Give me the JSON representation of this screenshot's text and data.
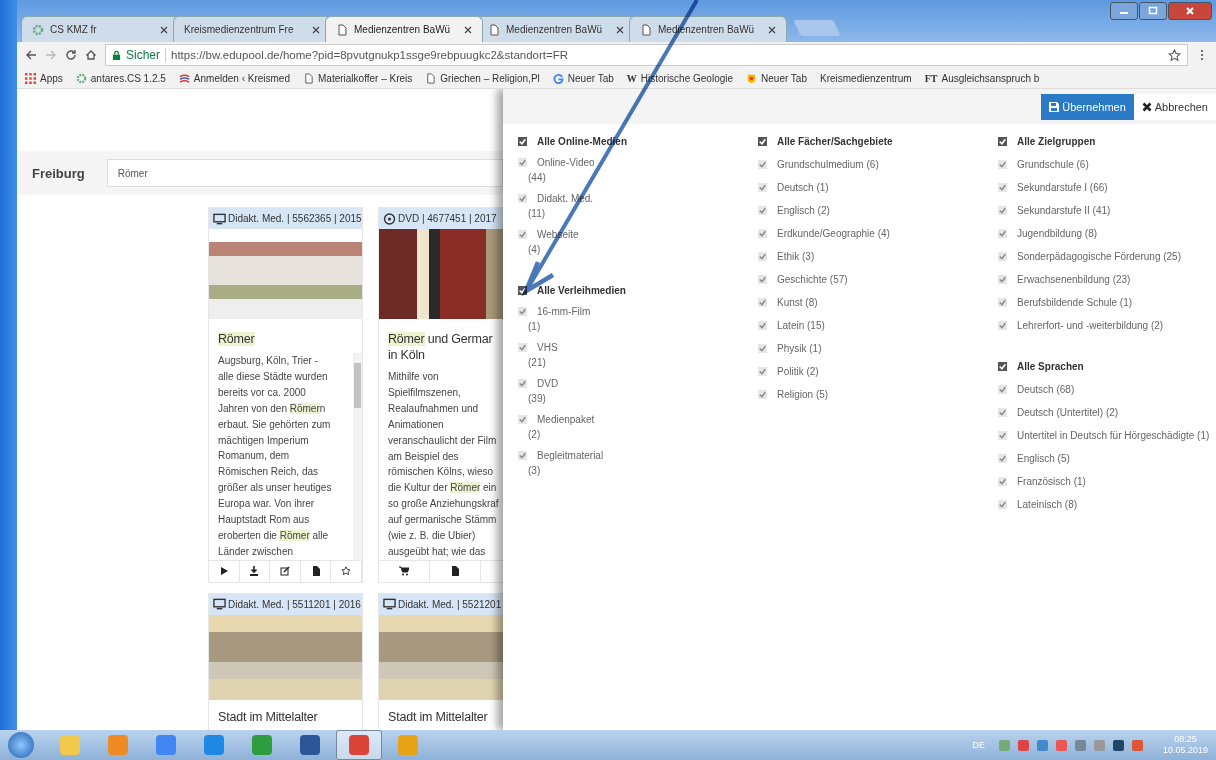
{
  "browser": {
    "tabs": [
      {
        "title": "CS KMZ fr",
        "selected": false
      },
      {
        "title": "Kreismedienzentrum Fre",
        "selected": false
      },
      {
        "title": "Medienzentren BaWü",
        "selected": true
      },
      {
        "title": "Medienzentren BaWü",
        "selected": false
      },
      {
        "title": "Medienzentren BaWü",
        "selected": false
      }
    ],
    "security": "Sicher",
    "url": "https://bw.edupool.de/home?pid=8pvutgnukp1ssge9rebpuugkc2&standort=FR",
    "bookmarks": [
      {
        "label": "Apps"
      },
      {
        "label": "antares.CS 1.2.5"
      },
      {
        "label": "Anmelden ‹ Kreismed"
      },
      {
        "label": "Materialkoffer – Kreis"
      },
      {
        "label": "Griechen – Religion,Pl"
      },
      {
        "label": "Neuer Tab"
      },
      {
        "label": "Historische Geologie",
        "mark": "W"
      },
      {
        "label": "Neuer Tab"
      },
      {
        "label": "Kreismedienzentrum"
      },
      {
        "label": "Ausgleichsanspruch b",
        "mark": "FT"
      }
    ]
  },
  "page": {
    "location": "Freiburg",
    "search": {
      "value": "Römer"
    },
    "cards": [
      {
        "kind": "didactic",
        "meta": "Didakt. Med. | 5562365 | 2015",
        "title": [
          [
            {
              "text": "Römer",
              "highlight": true
            }
          ]
        ],
        "description": [
          [
            {
              "text": "Augsburg, Köln, Trier -"
            }
          ],
          [
            {
              "text": "alle diese Städte wurden"
            }
          ],
          [
            {
              "text": "bereits vor ca. 2000"
            }
          ],
          [
            {
              "text": "Jahren von den "
            },
            {
              "text": "Römer",
              "highlight": true
            },
            {
              "text": "n"
            }
          ],
          [
            {
              "text": "erbaut. Sie gehörten zum"
            }
          ],
          [
            {
              "text": "mächtigen Imperium"
            }
          ],
          [
            {
              "text": "Romanum, dem"
            }
          ],
          [
            {
              "text": "Römischen Reich, das"
            }
          ],
          [
            {
              "text": "größer als unser heutiges"
            }
          ],
          [
            {
              "text": "Europa war. Von ihrer"
            }
          ],
          [
            {
              "text": "Hauptstadt Rom aus"
            }
          ],
          [
            {
              "text": "eroberten die "
            },
            {
              "text": "Römer",
              "highlight": true
            },
            {
              "text": " alle"
            }
          ],
          [
            {
              "text": "Länder zwischen"
            }
          ]
        ],
        "scrollable": true
      },
      {
        "kind": "dvd",
        "meta": "DVD | 4677451 | 2017",
        "title": [
          [
            {
              "text": "Römer",
              "highlight": true
            },
            {
              "text": " und Germar"
            }
          ],
          [
            {
              "text": "in Köln"
            }
          ]
        ],
        "description": [
          [
            {
              "text": "Mithilfe von"
            }
          ],
          [
            {
              "text": "Spielfilmszenen,"
            }
          ],
          [
            {
              "text": "Realaufnahmen und"
            }
          ],
          [
            {
              "text": "Animationen"
            }
          ],
          [
            {
              "text": "veranschaulicht der Film"
            }
          ],
          [
            {
              "text": "am Beispiel des"
            }
          ],
          [
            {
              "text": "römischen Kölns, wieso"
            }
          ],
          [
            {
              "text": "die Kultur der "
            },
            {
              "text": "Römer",
              "highlight": true
            },
            {
              "text": " ein"
            }
          ],
          [
            {
              "text": "so große Anziehungskraf"
            }
          ],
          [
            {
              "text": "auf germanische Stämm"
            }
          ],
          [
            {
              "text": "(wie z. B. die Ubier)"
            }
          ],
          [
            {
              "text": "ausgeübt hat; wie das"
            }
          ]
        ],
        "scrollable": false
      },
      {
        "kind": "didactic",
        "meta": "Didakt. Med. | 5511201 | 2016",
        "title": [
          [
            {
              "text": "Stadt im Mittelalter"
            }
          ]
        ]
      },
      {
        "kind": "didactic",
        "meta": "Didakt. Med. | 5521201",
        "title": [
          [
            {
              "text": "Stadt im Mittelalter"
            }
          ]
        ]
      }
    ]
  },
  "filter_panel": {
    "buttons": [
      {
        "label": "Übernehmen",
        "kind": "primary"
      },
      {
        "label": "Abbrechen",
        "kind": "cancel"
      }
    ],
    "columns": [
      [
        {
          "label": "Alle Online-Medien",
          "checked": true,
          "items": [
            {
              "label": "Online-Video",
              "count": "(44)",
              "checked": true
            },
            {
              "label": "Didakt. Med.",
              "count": "(11)",
              "checked": true
            },
            {
              "label": "Webseite",
              "count": "(4)",
              "checked": true
            }
          ]
        },
        {
          "label": "Alle Verleihmedien",
          "checked": true,
          "items": [
            {
              "label": "16-mm-Film",
              "count": "(1)",
              "checked": true
            },
            {
              "label": "VHS",
              "count": "(21)",
              "checked": true
            },
            {
              "label": "DVD",
              "count": "(39)",
              "checked": true
            },
            {
              "label": "Medienpaket",
              "count": "(2)",
              "checked": true
            },
            {
              "label": "Begleitmaterial",
              "count": "(3)",
              "checked": true
            }
          ]
        }
      ],
      [
        {
          "label": "Alle Fächer/Sachgebiete",
          "checked": true,
          "items": [
            {
              "label": "Grundschulmedium",
              "count": "(6)",
              "checked": true
            },
            {
              "label": "Deutsch",
              "count": "(1)",
              "checked": true
            },
            {
              "label": "Englisch",
              "count": "(2)",
              "checked": true
            },
            {
              "label": "Erdkunde/Geographie",
              "count": "(4)",
              "checked": true
            },
            {
              "label": "Ethik",
              "count": "(3)",
              "checked": true
            },
            {
              "label": "Geschichte",
              "count": "(57)",
              "checked": true
            },
            {
              "label": "Kunst",
              "count": "(8)",
              "checked": true
            },
            {
              "label": "Latein",
              "count": "(15)",
              "checked": true
            },
            {
              "label": "Physik",
              "count": "(1)",
              "checked": true
            },
            {
              "label": "Politik",
              "count": "(2)",
              "checked": true
            },
            {
              "label": "Religion",
              "count": "(5)",
              "checked": true
            }
          ]
        }
      ],
      [
        {
          "label": "Alle Zielgruppen",
          "checked": true,
          "items": [
            {
              "label": "Grundschule",
              "count": "(6)",
              "checked": true
            },
            {
              "label": "Sekundarstufe I",
              "count": "(66)",
              "checked": true
            },
            {
              "label": "Sekundarstufe II",
              "count": "(41)",
              "checked": true
            },
            {
              "label": "Jugendbildung",
              "count": "(8)",
              "checked": true
            },
            {
              "label": "Sonderpädagogische Förderung",
              "count": "(25)",
              "checked": true
            },
            {
              "label": "Erwachsenenbildung",
              "count": "(23)",
              "checked": true
            },
            {
              "label": "Berufsbildende Schule",
              "count": "(1)",
              "checked": true
            },
            {
              "label": "Lehrerfort- und -weiterbildung",
              "count": "(2)",
              "checked": true
            }
          ]
        },
        {
          "label": "Alle Sprachen",
          "checked": true,
          "items": [
            {
              "label": "Deutsch",
              "count": "(68)",
              "checked": true
            },
            {
              "label": "Deutsch (Untertitel)",
              "count": "(2)",
              "checked": true
            },
            {
              "label": "Untertitel in Deutsch für Hörgeschädigte",
              "count": "(1)",
              "checked": true
            },
            {
              "label": "Englisch",
              "count": "(5)",
              "checked": true
            },
            {
              "label": "Französisch",
              "count": "(1)",
              "checked": true
            },
            {
              "label": "Lateinisch",
              "count": "(8)",
              "checked": true
            }
          ]
        }
      ]
    ]
  },
  "taskbar": {
    "apps": [
      {
        "selected": false
      },
      {
        "selected": false
      },
      {
        "selected": false
      },
      {
        "selected": false
      },
      {
        "selected": false
      },
      {
        "selected": false
      },
      {
        "selected": true
      },
      {
        "selected": false
      }
    ],
    "language": "DE",
    "time": "08:25",
    "date": "10.05.2019"
  }
}
